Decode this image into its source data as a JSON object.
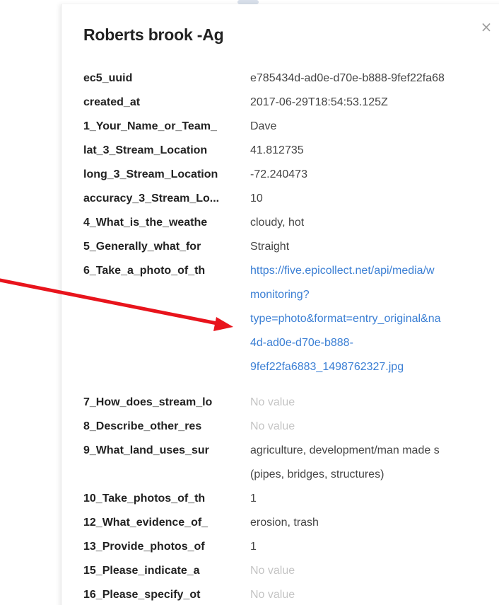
{
  "popup": {
    "title": "Roberts brook -Ag",
    "close_glyph": "×",
    "close_icon": "close-icon"
  },
  "fields": [
    {
      "key": "ec5_uuid",
      "value": "e785434d-ad0e-d70e-b888-9fef22fa68"
    },
    {
      "key": "created_at",
      "value": "2017-06-29T18:54:53.125Z"
    },
    {
      "key": "1_Your_Name_or_Team_",
      "value": "Dave"
    },
    {
      "key": "lat_3_Stream_Location",
      "value": "41.812735"
    },
    {
      "key": "long_3_Stream_Location",
      "value": "-72.240473"
    },
    {
      "key": "accuracy_3_Stream_Lo...",
      "value": "10"
    },
    {
      "key": "4_What_is_the_weathe",
      "value": "cloudy, hot"
    },
    {
      "key": "5_Generally_what_for",
      "value": "Straight"
    },
    {
      "key": "6_Take_a_photo_of_th",
      "value_lines": [
        "https://five.epicollect.net/api/media/w",
        "monitoring?",
        "type=photo&format=entry_original&na",
        "4d-ad0e-d70e-b888-",
        "9fef22fa6883_1498762327.jpg"
      ]
    },
    {
      "key": "7_How_does_stream_lo",
      "value": "No value"
    },
    {
      "key": "8_Describe_other_res",
      "value": "No value"
    },
    {
      "key": "9_What_land_uses_sur",
      "value_lines": [
        "agriculture, development/man made s",
        "(pipes, bridges, structures)"
      ]
    },
    {
      "key": "10_Take_photos_of_th",
      "value": "1"
    },
    {
      "key": "12_What_evidence_of_",
      "value": "erosion, trash"
    },
    {
      "key": "13_Provide_photos_of",
      "value": "1"
    },
    {
      "key": "15_Please_indicate_a",
      "value": "No value"
    },
    {
      "key": "16_Please_specify_ot",
      "value": "No value"
    }
  ],
  "colors": {
    "key_text": "#222222",
    "value_text": "#444444",
    "empty_value": "#c4c4c4",
    "link": "#3b7fd4",
    "annotation_arrow": "#e8141c"
  }
}
